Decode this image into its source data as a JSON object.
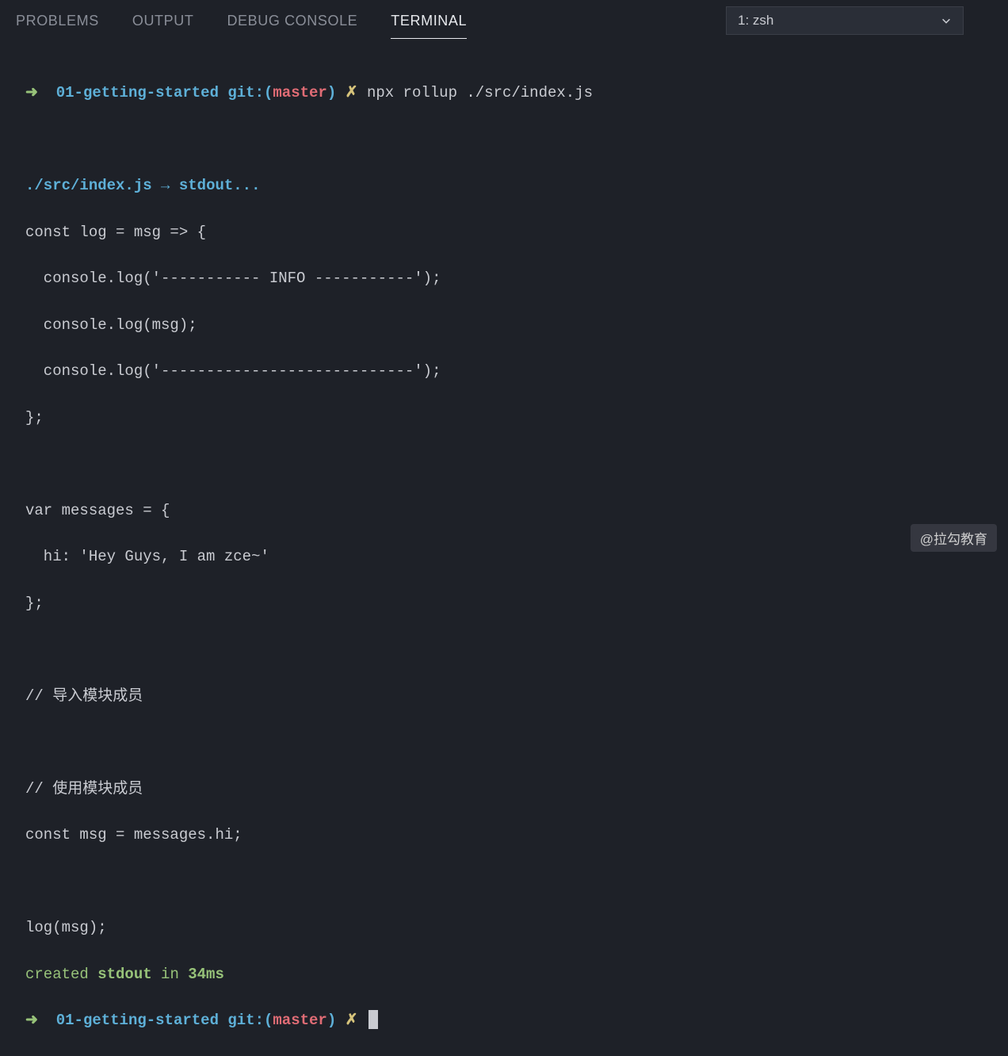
{
  "tabs": {
    "problems": "PROBLEMS",
    "output": "OUTPUT",
    "debug_console": "DEBUG CONSOLE",
    "terminal": "TERMINAL"
  },
  "dropdown": {
    "selected": "1: zsh"
  },
  "prompt1": {
    "arrow": "➜",
    "dir": "01-getting-started",
    "git_label": "git:(",
    "branch": "master",
    "git_close": ")",
    "dirty": "✗",
    "command": "npx rollup ./src/index.js"
  },
  "out": {
    "l1_a": "./src/index.js",
    "l1_b": " → ",
    "l1_c": "stdout...",
    "code1": "const log = msg => {",
    "code2": "  console.log('----------- INFO -----------');",
    "code3": "  console.log(msg);",
    "code4": "  console.log('----------------------------');",
    "code5": "};",
    "blank1": "",
    "code6": "var messages = {",
    "code7": "  hi: 'Hey Guys, I am zce~'",
    "code8": "};",
    "blank2": "",
    "code9": "// 导入模块成员",
    "blank3": "",
    "code10": "// 使用模块成员",
    "code11": "const msg = messages.hi;",
    "blank4": "",
    "code12": "log(msg);",
    "created_a": "created ",
    "created_b": "stdout",
    "created_c": " in ",
    "created_d": "34ms"
  },
  "prompt2": {
    "arrow": "➜",
    "dir": "01-getting-started",
    "git_label": "git:(",
    "branch": "master",
    "git_close": ")",
    "dirty": "✗"
  },
  "watermark": "@拉勾教育"
}
